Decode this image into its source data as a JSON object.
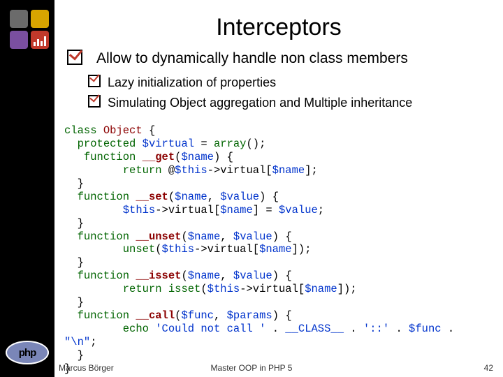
{
  "title": "Interceptors",
  "bullets": {
    "main": "Allow to dynamically handle non class members",
    "sub1": "Lazy initialization of properties",
    "sub2": "Simulating Object aggregation and Multiple inheritance"
  },
  "code": {
    "kw_class": "class",
    "classname": "Object",
    "kw_protected": "protected",
    "v_virtual": "$virtual",
    "kw_array": "array",
    "kw_function": "function",
    "m_get": "__get",
    "m_set": "__set",
    "m_unset": "__unset",
    "m_isset": "__isset",
    "m_call": "__call",
    "v_name": "$name",
    "v_value": "$value",
    "v_this": "$this",
    "v_func": "$func",
    "v_params": "$params",
    "kw_return": "return",
    "kw_unset": "unset",
    "kw_isset": "isset",
    "kw_echo": "echo",
    "s_could": "'Could not call '",
    "s_class": "__CLASS__",
    "s_colon": "'::'",
    "s_nl": "\"\\n\""
  },
  "footer": {
    "left": "Marcus Börger",
    "center": "Master OOP in PHP 5",
    "right": "42"
  },
  "logo": "php"
}
